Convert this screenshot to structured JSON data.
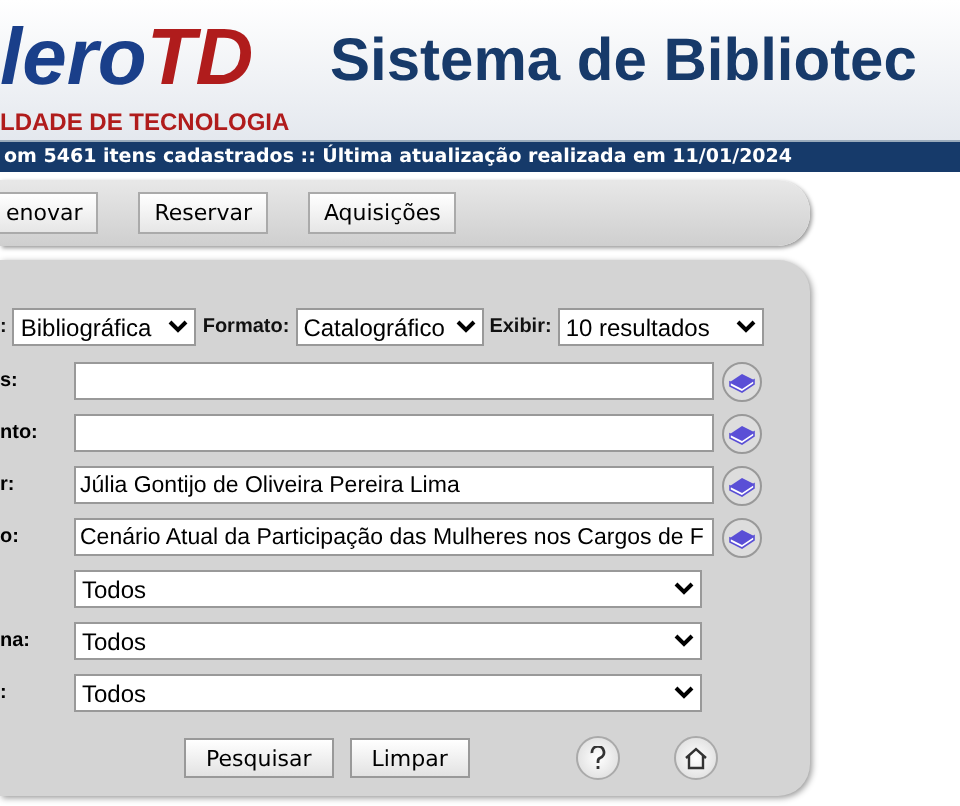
{
  "header": {
    "logo_left": "lero",
    "logo_right": "TD",
    "logo_subtitle": "LDADE DE TECNOLOGIA",
    "title": "Sistema de Bibliotec"
  },
  "status_bar": "om 5461 itens cadastrados :: Última atualização realizada em 11/01/2024",
  "nav_buttons": [
    "enovar",
    "Reservar",
    "Aquisições"
  ],
  "filters": [
    {
      "label": ":",
      "value": "Bibliográfica"
    },
    {
      "label": "Formato:",
      "value": "Catalográfico"
    },
    {
      "label": "Exibir:",
      "value": "10 resultados"
    }
  ],
  "fields": [
    {
      "kind": "text",
      "label": "s:"
    },
    {
      "kind": "text",
      "label": "nto:"
    },
    {
      "kind": "text",
      "label": "r:",
      "value": "Júlia Gontijo de Oliveira Pereira Lima"
    },
    {
      "kind": "text",
      "label": "o:",
      "value": "Cenário Atual da Participação das Mulheres nos Cargos de F"
    },
    {
      "kind": "select",
      "value": "Todos"
    },
    {
      "kind": "select",
      "label": "na:",
      "value": "Todos"
    },
    {
      "kind": "select",
      "label": ":",
      "value": "Todos"
    }
  ],
  "actions": [
    "Pesquisar",
    "Limpar"
  ]
}
